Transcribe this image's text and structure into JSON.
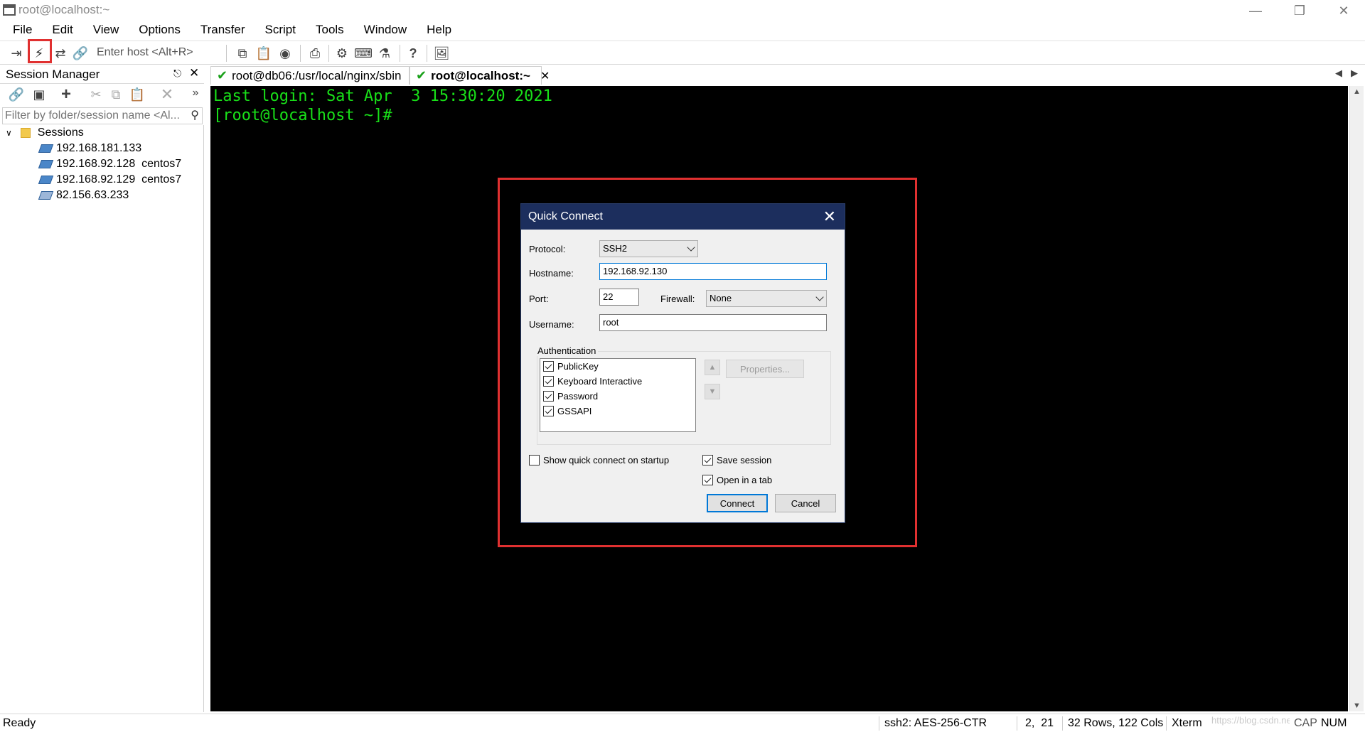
{
  "window": {
    "title": "root@localhost:~"
  },
  "menu": [
    "File",
    "Edit",
    "View",
    "Options",
    "Transfer",
    "Script",
    "Tools",
    "Window",
    "Help"
  ],
  "toolbar": {
    "enter_host_placeholder": "Enter host <Alt+R>"
  },
  "session_manager": {
    "title": "Session Manager",
    "filter_placeholder": "Filter by folder/session name <Al...",
    "root_folder": "Sessions",
    "sessions": [
      "192.168.181.133",
      "192.168.92.128  centos7",
      "192.168.92.129  centos7",
      "82.156.63.233"
    ]
  },
  "tabs": [
    {
      "label": "root@db06:/usr/local/nginx/sbin",
      "active": false
    },
    {
      "label": "root@localhost:~",
      "active": true
    }
  ],
  "terminal": {
    "lines": [
      "Last login: Sat Apr  3 15:30:20 2021",
      "[root@localhost ~]#"
    ],
    "color": "#19e019"
  },
  "dialog": {
    "title": "Quick Connect",
    "protocol_label": "Protocol:",
    "protocol_value": "SSH2",
    "hostname_label": "Hostname:",
    "hostname_value": "192.168.92.130",
    "port_label": "Port:",
    "port_value": "22",
    "firewall_label": "Firewall:",
    "firewall_value": "None",
    "username_label": "Username:",
    "username_value": "root",
    "auth_label": "Authentication",
    "auth_methods": [
      "PublicKey",
      "Keyboard Interactive",
      "Password",
      "GSSAPI"
    ],
    "properties_label": "Properties...",
    "show_on_startup_label": "Show quick connect on startup",
    "show_on_startup_checked": false,
    "save_session_label": "Save session",
    "save_session_checked": true,
    "open_in_tab_label": "Open in a tab",
    "open_in_tab_checked": true,
    "connect_label": "Connect",
    "cancel_label": "Cancel"
  },
  "status": {
    "ready": "Ready",
    "cipher": "ssh2: AES-256-CTR",
    "cursor": "2,  21",
    "size": "32 Rows, 122 Cols",
    "term": "Xterm",
    "cap": "CAP",
    "num": "NUM"
  },
  "watermark": "https://blog.csdn.net/Beyond_Hiterhaiming",
  "colors": {
    "highlight_red": "#e03030",
    "dialog_title_bg": "#1c2e5d",
    "terminal_bg": "#000000"
  }
}
